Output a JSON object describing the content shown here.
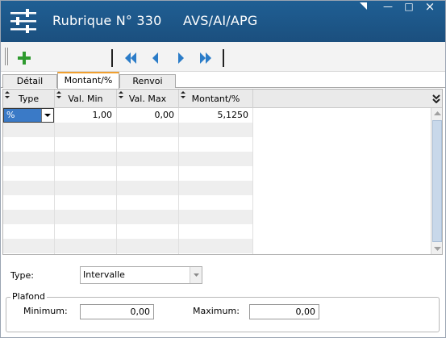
{
  "window": {
    "title": "Rubrique N° 330",
    "subtitle": "AVS/AI/APG",
    "controls": {
      "minimize": "—",
      "maximize": "□",
      "close": "×"
    }
  },
  "toolbar": {
    "buttons": [
      "add-icon",
      "first-icon",
      "previous-icon",
      "next-icon",
      "last-icon"
    ],
    "colors": {
      "add": "#2e9a2e",
      "nav": "#2b7cc8"
    }
  },
  "tabs": [
    {
      "label": "Détail",
      "active": false
    },
    {
      "label": "Montant/%",
      "active": true
    },
    {
      "label": "Renvoi",
      "active": false
    }
  ],
  "grid": {
    "columns": [
      "Type",
      "Val. Min",
      "Val. Max",
      "Montant/%"
    ],
    "rows": [
      {
        "type": "%",
        "val_min": "1,00",
        "val_max": "0,00",
        "montant": "5,1250"
      }
    ],
    "empty_rows": 10
  },
  "form": {
    "type_label": "Type:",
    "type_value": "Intervalle",
    "plafond_legend": "Plafond",
    "minimum_label": "Minimum:",
    "minimum_value": "0,00",
    "maximum_label": "Maximum:",
    "maximum_value": "0,00"
  },
  "colors": {
    "titlebar": "#1f5f94",
    "tab_accent": "#f0a030",
    "selection": "#3a7ac7",
    "scroll_thumb": "#c8d8ea"
  }
}
